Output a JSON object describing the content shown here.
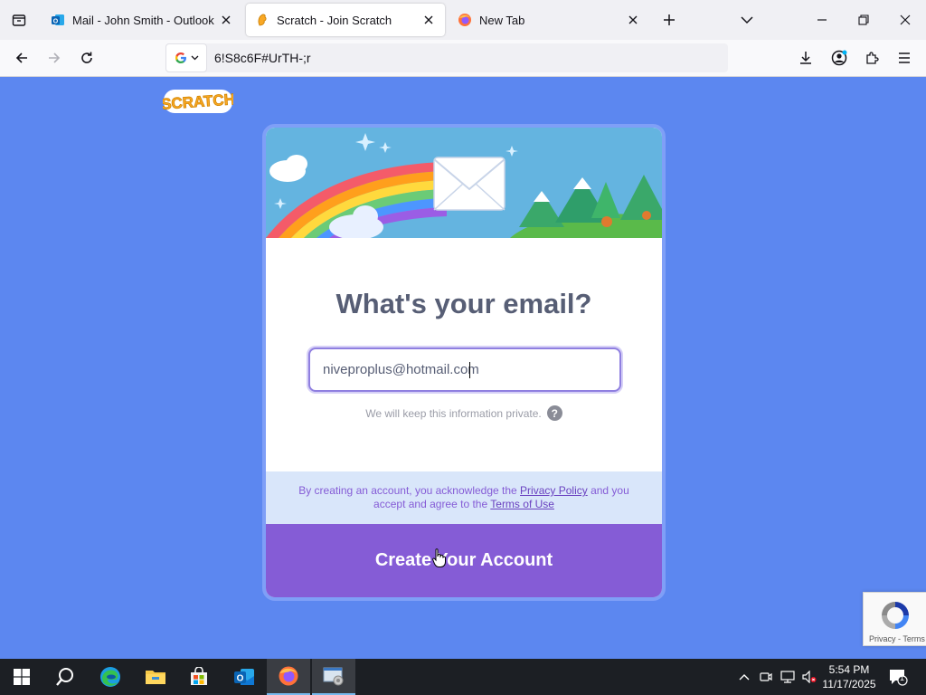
{
  "browser": {
    "tabs": [
      {
        "title": "Mail - John Smith - Outlook",
        "active": false
      },
      {
        "title": "Scratch - Join Scratch",
        "active": true
      },
      {
        "title": "New Tab",
        "active": false
      }
    ],
    "url": "6!S8c6F#UrTH-;r"
  },
  "page": {
    "logo_text": "SCRATCH",
    "heading": "What's your email?",
    "email_value": "niveproplus@hotmail.com",
    "privacy_note": "We will keep this information private.",
    "help_glyph": "?",
    "legal_prefix": "By creating an account, you acknowledge the",
    "privacy_policy_link": "Privacy Policy",
    "legal_middle": "and you accept and agree to the",
    "terms_link": "Terms of Use",
    "create_button": "Create Your Account"
  },
  "recaptcha": {
    "links": "Privacy - Terms"
  },
  "taskbar": {
    "time": "5:54 PM",
    "date": "11/17/2025",
    "notification_count": "1"
  },
  "colors": {
    "page_background": "#5c87f0",
    "button_purple": "#855cd6",
    "heading_gray": "#575e75",
    "legal_background": "#d9e6fa"
  },
  "icons": [
    "tab-list-icon",
    "outlook-icon",
    "scratch-icon",
    "firefox-icon",
    "close-icon",
    "plus-icon",
    "chevron-down-icon",
    "minimize-icon",
    "restore-icon",
    "back-icon",
    "forward-icon",
    "reload-icon",
    "google-icon",
    "download-icon",
    "account-icon",
    "extensions-icon",
    "menu-icon",
    "help-icon",
    "windows-start-icon",
    "search-icon",
    "edge-icon",
    "file-explorer-icon",
    "store-icon",
    "outlook-taskbar-icon",
    "chevron-up-icon",
    "camera-icon",
    "network-icon",
    "volume-mute-icon",
    "notification-icon"
  ]
}
